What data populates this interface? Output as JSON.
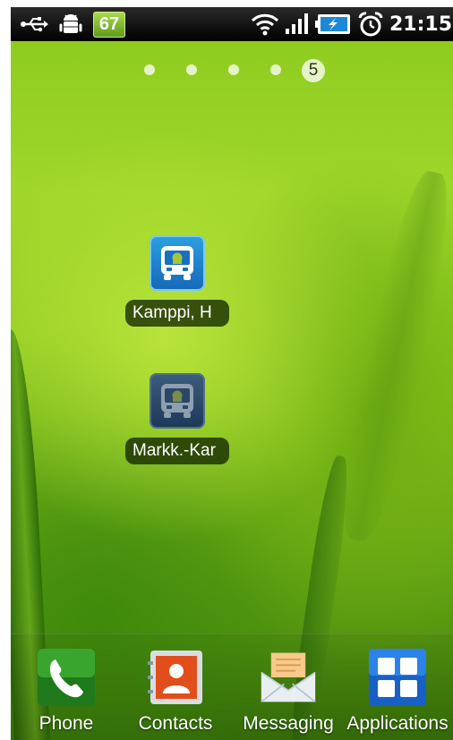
{
  "status_bar": {
    "notification_icons": [
      "usb-icon",
      "android-debug-icon"
    ],
    "badge_count": "67",
    "status_icons": [
      "wifi-icon",
      "signal-icon",
      "battery-charging-icon",
      "alarm-icon"
    ],
    "clock": "21:15"
  },
  "pager": {
    "dots": 4,
    "current_page": "5"
  },
  "shortcuts": [
    {
      "label": "Kamppi, H",
      "icon": "bus-app-icon",
      "style": "bright"
    },
    {
      "label": "Markk.-Kar",
      "icon": "bus-app-icon",
      "style": "dark"
    }
  ],
  "dock": [
    {
      "label": "Phone",
      "icon": "phone-icon"
    },
    {
      "label": "Contacts",
      "icon": "contacts-icon"
    },
    {
      "label": "Messaging",
      "icon": "messaging-icon"
    },
    {
      "label": "Applications",
      "icon": "applications-grid-icon"
    }
  ],
  "colors": {
    "status_bar_bg": "#000000",
    "badge_green": "#7cb82f",
    "wallpaper_green": "#8cca1e",
    "label_bg": "#142800"
  }
}
